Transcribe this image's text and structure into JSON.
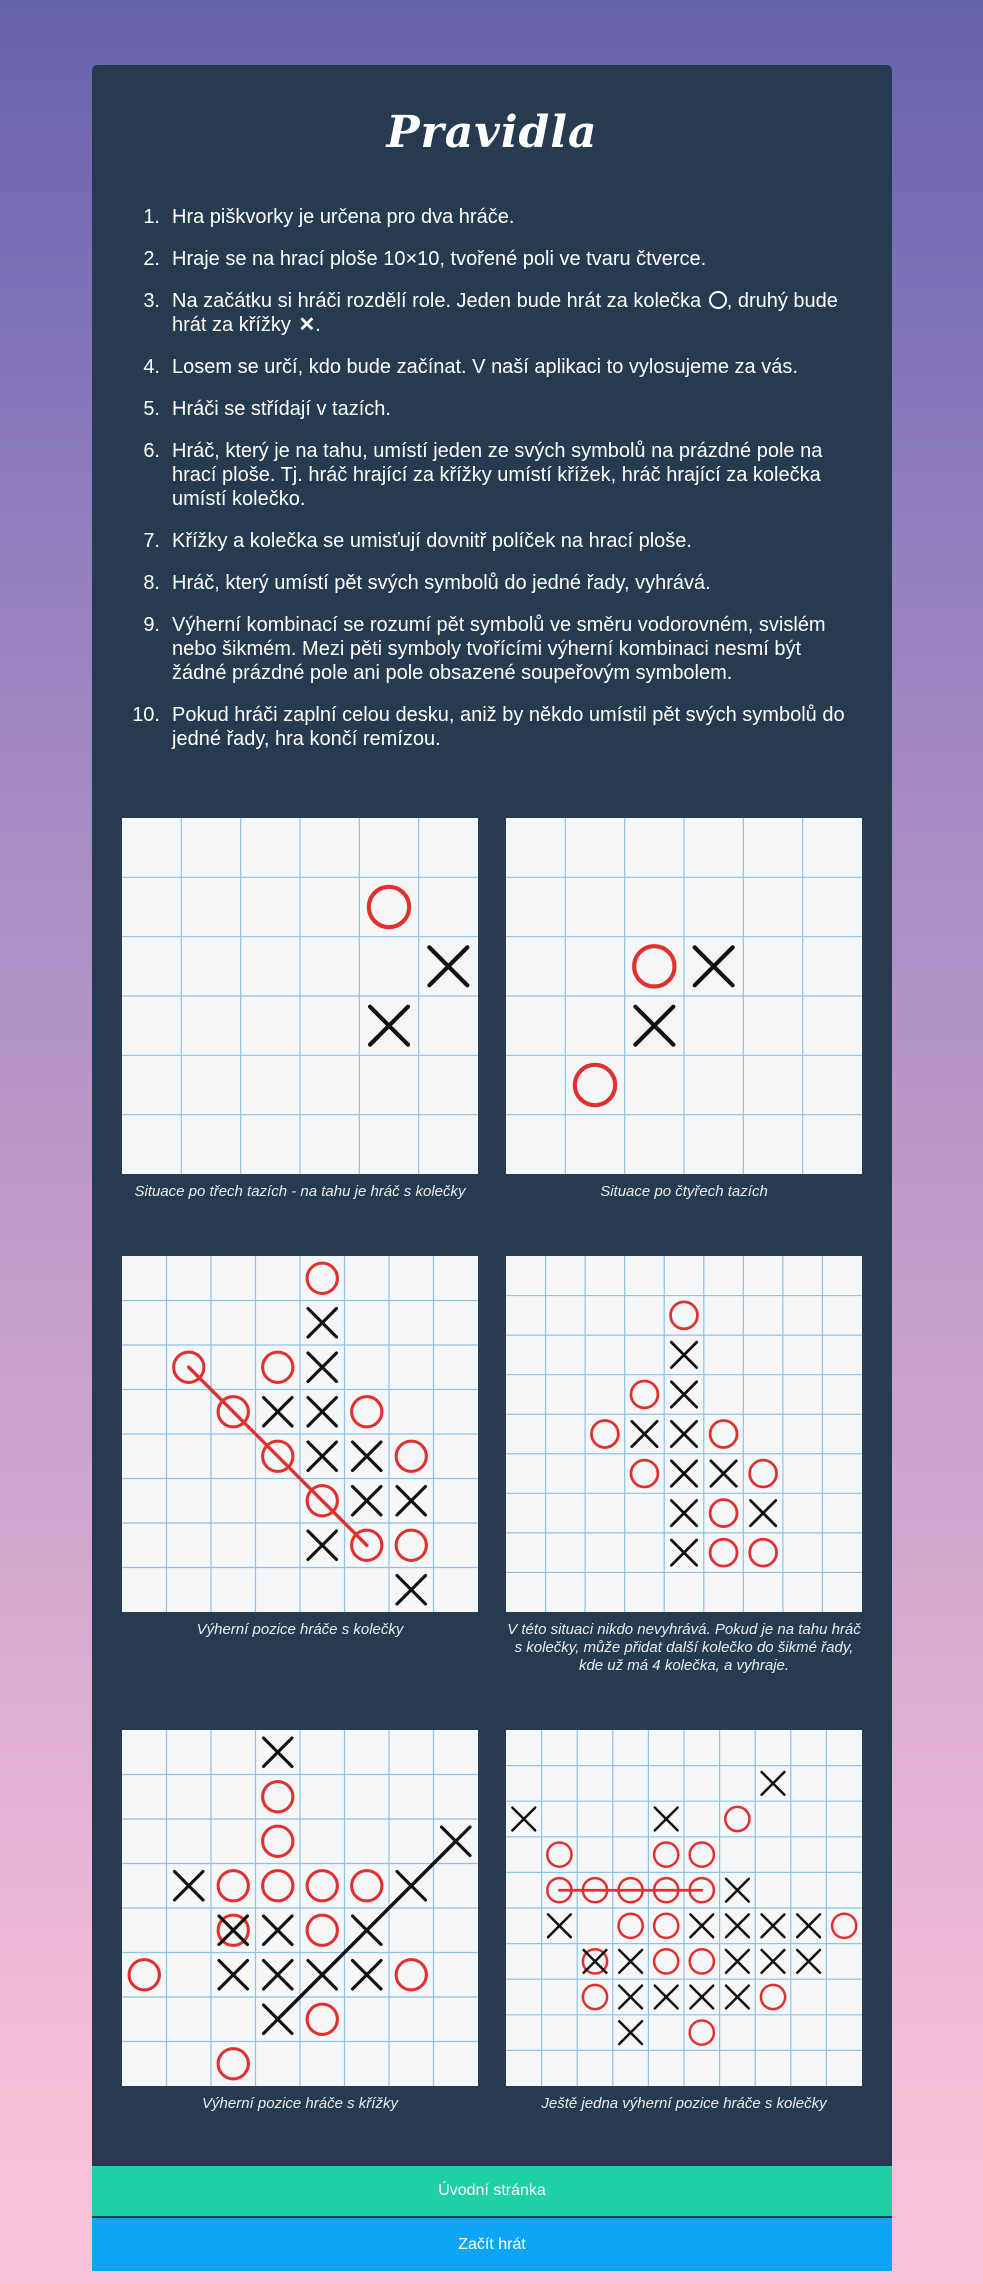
{
  "title": "Pravidla",
  "rules": [
    {
      "num": "1.",
      "text": "Hra piškvorky je určena pro dva hráče."
    },
    {
      "num": "2.",
      "text": "Hraje se na hrací ploše 10×10, tvořené poli ve tvaru čtverce."
    },
    {
      "num": "3.",
      "text_a": "Na začátku si hráči rozdělí role. Jeden bude hrát za kolečka",
      "text_b": ", druhý bude hrát za křížky",
      "text_c": "."
    },
    {
      "num": "4.",
      "text": "Losem se určí, kdo bude začínat. V naší aplikaci to vylosujeme za vás."
    },
    {
      "num": "5.",
      "text": "Hráči se střídají v tazích."
    },
    {
      "num": "6.",
      "text": "Hráč, který je na tahu, umístí jeden ze svých symbolů na prázdné pole na hrací ploše. Tj. hráč hrající za křížky umístí křížek, hráč hrající za kolečka umístí kolečko."
    },
    {
      "num": "7.",
      "text": "Křížky a kolečka se umisťují dovnitř políček na hrací ploše."
    },
    {
      "num": "8.",
      "text": "Hráč, který umístí pět svých symbolů do jedné řady, vyhrává."
    },
    {
      "num": "9.",
      "text": "Výherní kombinací se rozumí pět symbolů ve směru vodorovném, svislém nebo šikmém. Mezi pěti symboly tvořícími výherní kombinaci nesmí být žádné prázdné pole ani pole obsazené soupeřovým symbolem."
    },
    {
      "num": "10.",
      "text": "Pokud hráči zaplní celou desku, aniž by někdo umístil pět svých symbolů do jedné řady, hra končí remízou."
    }
  ],
  "icons": {
    "circle": "circle-icon",
    "cross": "cross-icon"
  },
  "colors": {
    "card": "#263b50",
    "home_button": "#1fcfa6",
    "play_button": "#0ea5f7",
    "circle": "#e03131",
    "cross": "#111111",
    "grid": "#8ec3ea"
  },
  "figures": [
    {
      "caption": "Situace po třech tazích - na tahu je hráč s kolečky",
      "board": {
        "size": 6,
        "o": [
          [
            4,
            1
          ]
        ],
        "x": [
          [
            5,
            2
          ],
          [
            4,
            3
          ]
        ],
        "lines": []
      }
    },
    {
      "caption": "Situace po čtyřech tazích",
      "board": {
        "size": 6,
        "o": [
          [
            2,
            2
          ],
          [
            1,
            4
          ]
        ],
        "x": [
          [
            3,
            2
          ],
          [
            2,
            3
          ]
        ],
        "lines": []
      }
    },
    {
      "caption": "Výherní pozice hráče s kolečky",
      "board": {
        "size": 8,
        "o": [
          [
            4,
            0
          ],
          [
            3,
            2
          ],
          [
            1,
            2
          ],
          [
            2,
            3
          ],
          [
            5,
            3
          ],
          [
            3,
            4
          ],
          [
            6,
            4
          ],
          [
            4,
            5
          ],
          [
            5,
            6
          ],
          [
            6,
            6
          ]
        ],
        "x": [
          [
            4,
            1
          ],
          [
            4,
            2
          ],
          [
            3,
            3
          ],
          [
            4,
            3
          ],
          [
            4,
            4
          ],
          [
            5,
            4
          ],
          [
            5,
            5
          ],
          [
            6,
            5
          ],
          [
            4,
            6
          ],
          [
            6,
            7
          ]
        ],
        "lines": [
          [
            1,
            2,
            5,
            6
          ]
        ]
      }
    },
    {
      "caption": "V této situaci nikdo nevyhrává. Pokud je na tahu hráč s kolečky, může přidat další kolečko do šikmé řady, kde už má 4 kolečka, a vyhraje.",
      "board": {
        "size": 9,
        "o": [
          [
            4,
            1
          ],
          [
            3,
            3
          ],
          [
            2,
            4
          ],
          [
            5,
            4
          ],
          [
            3,
            5
          ],
          [
            6,
            5
          ],
          [
            5,
            6
          ],
          [
            5,
            7
          ],
          [
            6,
            7
          ]
        ],
        "x": [
          [
            4,
            2
          ],
          [
            4,
            3
          ],
          [
            3,
            4
          ],
          [
            4,
            4
          ],
          [
            4,
            5
          ],
          [
            5,
            5
          ],
          [
            4,
            6
          ],
          [
            6,
            6
          ],
          [
            4,
            7
          ]
        ],
        "lines": []
      }
    },
    {
      "caption": "Výherní pozice hráče s křížky",
      "board": {
        "size": 8,
        "o": [
          [
            3,
            1
          ],
          [
            3,
            2
          ],
          [
            2,
            3
          ],
          [
            3,
            3
          ],
          [
            4,
            3
          ],
          [
            5,
            3
          ],
          [
            2,
            4
          ],
          [
            4,
            4
          ],
          [
            0,
            5
          ],
          [
            6,
            5
          ],
          [
            4,
            6
          ],
          [
            2,
            7
          ]
        ],
        "x": [
          [
            3,
            0
          ],
          [
            7,
            2
          ],
          [
            1,
            3
          ],
          [
            6,
            3
          ],
          [
            2,
            4
          ],
          [
            3,
            4
          ],
          [
            5,
            4
          ],
          [
            2,
            5
          ],
          [
            3,
            5
          ],
          [
            4,
            5
          ],
          [
            5,
            5
          ],
          [
            3,
            6
          ]
        ],
        "lines": [
          [
            3,
            6,
            7,
            2
          ]
        ]
      }
    },
    {
      "caption": "Ještě jedna výherní pozice hráče s kolečky",
      "board": {
        "size": 10,
        "o": [
          [
            6,
            2
          ],
          [
            1,
            3
          ],
          [
            4,
            3
          ],
          [
            5,
            3
          ],
          [
            1,
            4
          ],
          [
            2,
            4
          ],
          [
            3,
            4
          ],
          [
            4,
            4
          ],
          [
            5,
            4
          ],
          [
            3,
            5
          ],
          [
            4,
            5
          ],
          [
            9,
            5
          ],
          [
            2,
            6
          ],
          [
            4,
            6
          ],
          [
            5,
            6
          ],
          [
            2,
            7
          ],
          [
            7,
            7
          ],
          [
            5,
            8
          ]
        ],
        "x": [
          [
            7,
            1
          ],
          [
            0,
            2
          ],
          [
            4,
            2
          ],
          [
            6,
            4
          ],
          [
            1,
            5
          ],
          [
            5,
            5
          ],
          [
            6,
            5
          ],
          [
            7,
            5
          ],
          [
            8,
            5
          ],
          [
            2,
            6
          ],
          [
            3,
            6
          ],
          [
            6,
            6
          ],
          [
            7,
            6
          ],
          [
            8,
            6
          ],
          [
            3,
            7
          ],
          [
            4,
            7
          ],
          [
            5,
            7
          ],
          [
            6,
            7
          ],
          [
            3,
            8
          ]
        ],
        "lines": [
          [
            1,
            4,
            5,
            4
          ]
        ]
      }
    }
  ],
  "buttons": {
    "home": "Úvodní stránka",
    "play": "Začít hrát"
  }
}
